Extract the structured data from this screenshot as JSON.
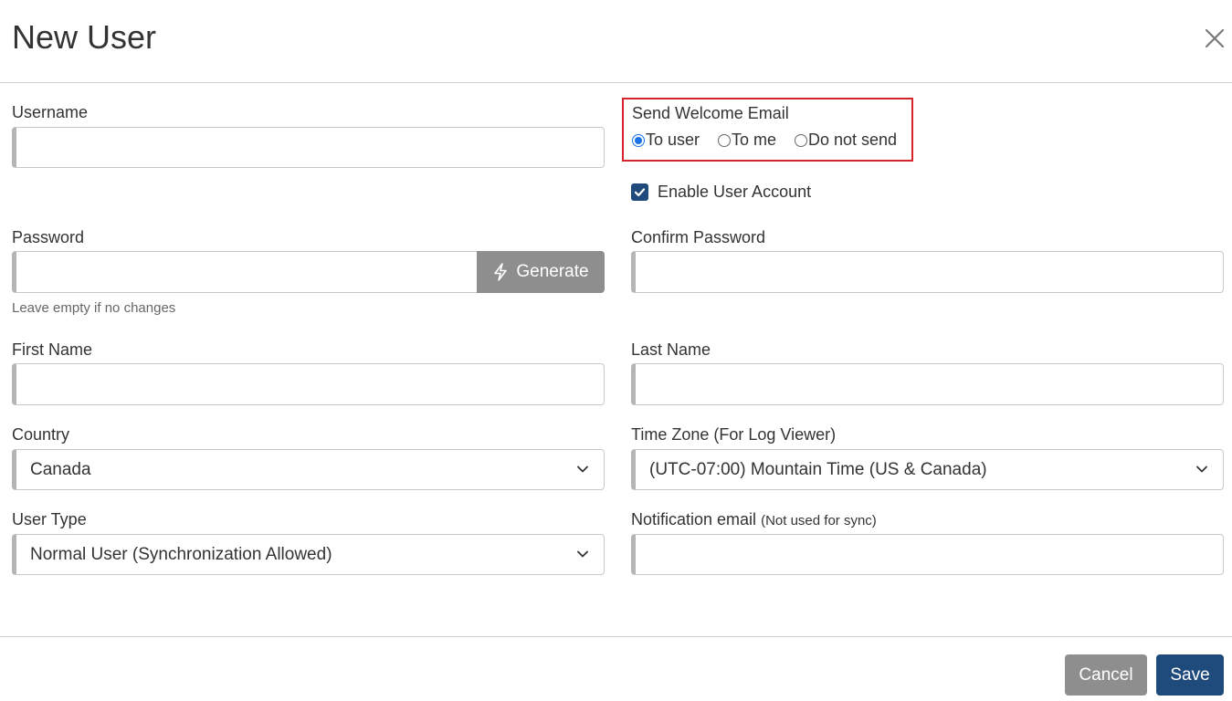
{
  "dialog": {
    "title": "New User"
  },
  "form": {
    "username": {
      "label": "Username",
      "value": ""
    },
    "welcome_email": {
      "label": "Send Welcome Email",
      "options": [
        "To user",
        "To me",
        "Do not send"
      ],
      "selected": "To user"
    },
    "enable_account": {
      "label": "Enable User Account",
      "checked": true
    },
    "password": {
      "label": "Password",
      "value": "",
      "help": "Leave empty if no changes",
      "generate_label": "Generate"
    },
    "confirm_password": {
      "label": "Confirm Password",
      "value": ""
    },
    "first_name": {
      "label": "First Name",
      "value": ""
    },
    "last_name": {
      "label": "Last Name",
      "value": ""
    },
    "country": {
      "label": "Country",
      "value": "Canada"
    },
    "time_zone": {
      "label": "Time Zone (For Log Viewer)",
      "value": "(UTC-07:00) Mountain Time (US & Canada)"
    },
    "user_type": {
      "label": "User Type",
      "value": "Normal User (Synchronization Allowed)"
    },
    "notification_email": {
      "label": "Notification email",
      "note": "(Not used for sync)",
      "value": ""
    }
  },
  "footer": {
    "cancel_label": "Cancel",
    "save_label": "Save"
  },
  "colors": {
    "primary": "#1f4a7c",
    "secondary": "#8e8e8e",
    "highlight_border": "#d9242b",
    "radio_accent": "#1a73e8"
  },
  "icons": [
    "close-icon",
    "lightning-icon",
    "chevron-down-icon",
    "checkmark-icon"
  ]
}
